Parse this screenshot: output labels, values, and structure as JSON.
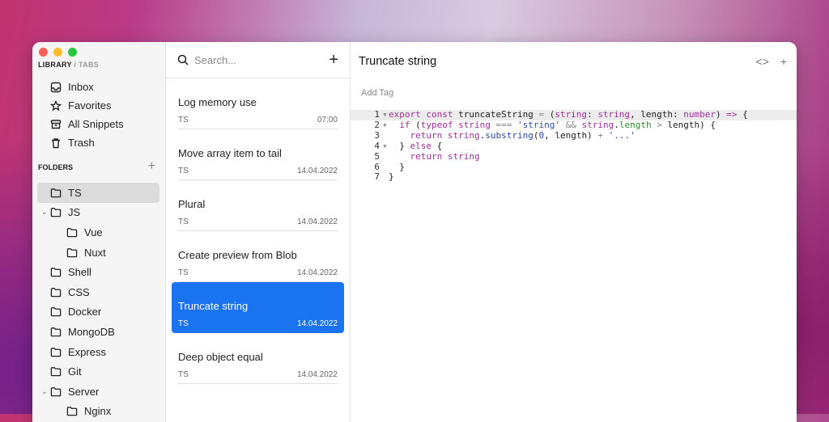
{
  "sidebar": {
    "library": "LIBRARY",
    "sep": " / ",
    "tabs": "TABS",
    "nav": [
      {
        "label": "Inbox",
        "icon": "inbox-icon"
      },
      {
        "label": "Favorites",
        "icon": "star-icon"
      },
      {
        "label": "All Snippets",
        "icon": "archive-icon"
      },
      {
        "label": "Trash",
        "icon": "trash-icon"
      }
    ],
    "folders_title": "FOLDERS",
    "add": "+",
    "folders": [
      {
        "label": "TS",
        "indent": 0,
        "selected": true
      },
      {
        "label": "JS",
        "indent": 0,
        "chevron": "⌄"
      },
      {
        "label": "Vue",
        "indent": 1
      },
      {
        "label": "Nuxt",
        "indent": 1
      },
      {
        "label": "Shell",
        "indent": 0
      },
      {
        "label": "CSS",
        "indent": 0
      },
      {
        "label": "Docker",
        "indent": 0
      },
      {
        "label": "MongoDB",
        "indent": 0
      },
      {
        "label": "Express",
        "indent": 0
      },
      {
        "label": "Git",
        "indent": 0
      },
      {
        "label": "Server",
        "indent": 0,
        "chevron": "⌄"
      },
      {
        "label": "Nginx",
        "indent": 1
      }
    ]
  },
  "list": {
    "search_placeholder": "Search...",
    "add": "+",
    "items": [
      {
        "title": "Log memory use",
        "lang": "TS",
        "date": "07:00"
      },
      {
        "title": "Move array item to tail",
        "lang": "TS",
        "date": "14.04.2022"
      },
      {
        "title": "Plural",
        "lang": "TS",
        "date": "14.04.2022"
      },
      {
        "title": "Create preview from Blob",
        "lang": "TS",
        "date": "14.04.2022"
      },
      {
        "title": "Truncate string",
        "lang": "TS",
        "date": "14.04.2022",
        "active": true
      },
      {
        "title": "Deep object equal",
        "lang": "TS",
        "date": "14.04.2022"
      }
    ]
  },
  "editor": {
    "title": "Truncate string",
    "code_icon": "<>",
    "add": "+",
    "add_tag": "Add Tag",
    "lines": [
      {
        "n": "1",
        "fold": true,
        "t": [
          [
            "export const ",
            "k"
          ],
          [
            "truncateString ",
            "p"
          ],
          [
            "= ",
            "o"
          ],
          [
            "(",
            "p"
          ],
          [
            "string",
            "k"
          ],
          [
            ": ",
            "p"
          ],
          [
            "string",
            "k"
          ],
          [
            ", length: ",
            "p"
          ],
          [
            "number",
            "k"
          ],
          [
            ") ",
            "p"
          ],
          [
            "=> ",
            "k"
          ],
          [
            "{",
            "p"
          ]
        ]
      },
      {
        "n": "2",
        "fold": true,
        "t": [
          [
            "  ",
            "p"
          ],
          [
            "if ",
            "k"
          ],
          [
            "(",
            "p"
          ],
          [
            "typeof ",
            "k"
          ],
          [
            "string ",
            "k"
          ],
          [
            "=== ",
            "o"
          ],
          [
            "'string' ",
            "s"
          ],
          [
            "&& ",
            "o"
          ],
          [
            "string",
            "k"
          ],
          [
            ".",
            "p"
          ],
          [
            "length ",
            "g"
          ],
          [
            "> ",
            "o"
          ],
          [
            "length) {",
            "p"
          ]
        ]
      },
      {
        "n": "3",
        "t": [
          [
            "    ",
            "p"
          ],
          [
            "return ",
            "k"
          ],
          [
            "string",
            "k"
          ],
          [
            ".",
            "p"
          ],
          [
            "substring",
            "s"
          ],
          [
            "(",
            "p"
          ],
          [
            "0",
            "n"
          ],
          [
            ", length) ",
            "p"
          ],
          [
            "+ ",
            "o"
          ],
          [
            "'...'",
            "s"
          ]
        ]
      },
      {
        "n": "4",
        "fold": true,
        "t": [
          [
            "  } ",
            "p"
          ],
          [
            "else ",
            "k"
          ],
          [
            "{",
            "p"
          ]
        ]
      },
      {
        "n": "5",
        "t": [
          [
            "    ",
            "p"
          ],
          [
            "return ",
            "k"
          ],
          [
            "string",
            "k"
          ]
        ]
      },
      {
        "n": "6",
        "t": [
          [
            "  }",
            "p"
          ]
        ]
      },
      {
        "n": "7",
        "t": [
          [
            "}",
            "p"
          ]
        ]
      }
    ]
  }
}
